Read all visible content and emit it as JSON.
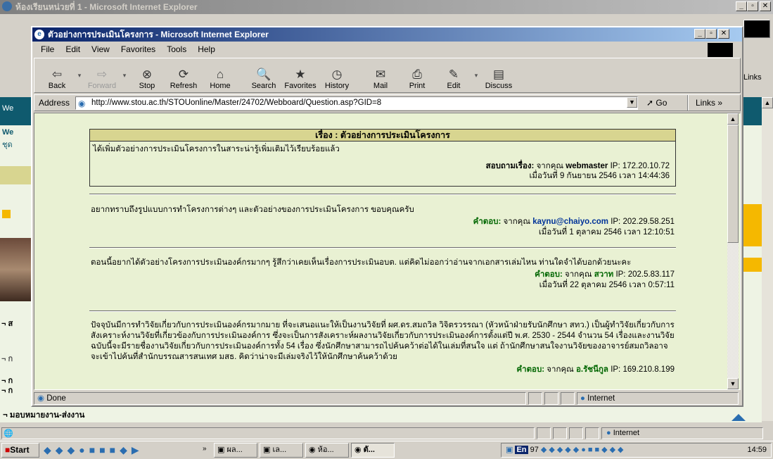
{
  "outer": {
    "title": "ห้องเรียนหน่วยที่ 1 - Microsoft Internet Explorer",
    "sidebar_snippets": [
      "We",
      "We",
      "ชุด",
      "ส",
      "ก",
      "ก",
      "ก"
    ],
    "left_menu_bottom": "มอบหมายงาน-ส่งงาน",
    "status_zone": "Internet",
    "links": "Links"
  },
  "window": {
    "title": "ตัวอย่างการประเมินโครงการ - Microsoft Internet Explorer",
    "menu": [
      "File",
      "Edit",
      "View",
      "Favorites",
      "Tools",
      "Help"
    ],
    "toolbar": [
      {
        "label": "Back",
        "icon": "⇦"
      },
      {
        "label": "Forward",
        "icon": "⇨"
      },
      {
        "label": "Stop",
        "icon": "⊗"
      },
      {
        "label": "Refresh",
        "icon": "⟳"
      },
      {
        "label": "Home",
        "icon": "⌂"
      },
      {
        "label": "Search",
        "icon": "🔍"
      },
      {
        "label": "Favorites",
        "icon": "★"
      },
      {
        "label": "History",
        "icon": "◷"
      },
      {
        "label": "Mail",
        "icon": "✉"
      },
      {
        "label": "Print",
        "icon": "⎙"
      },
      {
        "label": "Edit",
        "icon": "✎"
      },
      {
        "label": "Discuss",
        "icon": "▤"
      }
    ],
    "address_label": "Address",
    "address_value": "http://www.stou.ac.th/STOUonline/Master/24702/Webboard/Question.asp?GID=8",
    "go_label": "Go",
    "links_label": "Links",
    "status_text": "Done",
    "status_zone": "Internet"
  },
  "topic": {
    "header": "เรื่อง : ตัวอย่างการประเมินโครงการ",
    "body": "ได้เพิ่มตัวอย่างการประเมินโครงการในสาระน่ารู้เพิ่มเติมไว้เรียบร้อยแล้ว",
    "label": "สอบถามเรื่อง:",
    "from": "จากคุณ",
    "user": "webmaster",
    "ip": "IP: 172.20.10.72",
    "date": "เมื่อวันที่ 9 กันยายน 2546 เวลา 14:44:36"
  },
  "replies": [
    {
      "body": "อยากทราบถึงรูปแบบการทำโครงการต่างๆ และตัวอย่างของการประเมินโครงการ ขอบคุณครับ",
      "label": "คำตอบ:",
      "from": "จากคุณ",
      "user": "kaynu@chaiyo.com",
      "ip": "IP: 202.29.58.251",
      "date": "เมื่อวันที่ 1 ตุลาคม 2546 เวลา 12:10:51"
    },
    {
      "body": "ตอนนี้อยากได้ตัวอย่างโครงการประเมินองค์กรมากๆ รู้สึกว่าเคยเห็นเรื่องการประเมินอบต. แต่คิดไม่ออกว่าอ่านจากเอกสารเล่มไหน ท่านใดจำได้บอกด้วยนะคะ",
      "label": "คำตอบ:",
      "from": "จากคุณ",
      "user": "สวาท",
      "ip": "IP: 202.5.83.117",
      "date": "เมื่อวันที่ 22 ตุลาคม 2546 เวลา 0:57:11"
    },
    {
      "body": "ปัจจุบันมีการทำวิจัยเกี่ยวกับการประเมินองค์กรมากมาย ที่จะเสนอแนะให้เป็นงานวิจัยที่ ผศ.ดร.สมถวิล วิจิตรวรรณา (หัวหน้าฝ่ายรับนักศึกษา สทว.) เป็นผู้ทำวิจัยเกี่ยวกับการสังเคราะห์งานวิจัยที่เกี่ยวข้องกับการประเมินองค์การ ซึ่งจะเป็นการสังเคราะห์ผลงานวิจัยเกี่ยวกับการประเมินองค์การตั้งแต่ปี พ.ศ. 2530 - 2544 จำนวน 54 เรื่องและงานวิจัยฉบับนี้จะมีรายชื่องานวิจัยเกี่ยวกับการประเมินองค์การทั้ง 54 เรื่อง ซึ่งนักศึกษาสามารถไปค้นคว้าต่อได้ในเล่มที่สนใจ แต่ ถ้านักศึกษาสนใจงานวิจัยของอาจารย์สมถวิลอาจจะเข้าไปค้นที่สำนักบรรณสารสนเทศ มสธ. คิดว่าน่าจะมีเล่มจริงไว้ให้นักศึกษาค้นคว้าด้วย",
      "label": "คำตอบ:",
      "from": "จากคุณ",
      "user": "อ.รัชนีกูล",
      "ip": "IP: 169.210.8.199"
    }
  ],
  "taskbar": {
    "start": "Start",
    "tasks": [
      "ผล...",
      "เล...",
      "ห้อ...",
      "ตั..."
    ],
    "tray_lang": "En",
    "tray_num": "97",
    "clock": "14:59"
  },
  "colors": {
    "page_bg": "#e9f1d3",
    "topic_header_bg": "#d8d590",
    "title_active": "#0a246a"
  }
}
